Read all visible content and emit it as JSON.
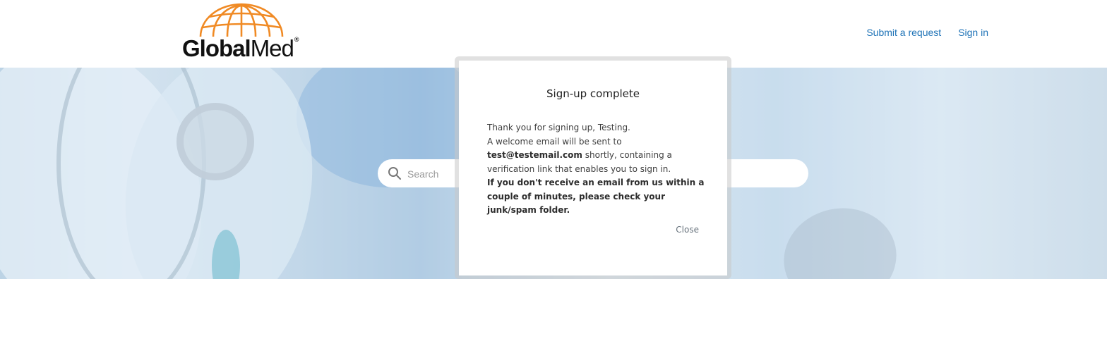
{
  "header": {
    "logo_alt": "GlobalMed",
    "logo_text_bold": "Global",
    "logo_text_light": "Med",
    "logo_reg": "®",
    "nav": {
      "submit_request": "Submit a request",
      "sign_in": "Sign in"
    }
  },
  "hero": {
    "search": {
      "placeholder": "Search",
      "icon": "search-icon"
    }
  },
  "modal": {
    "title": "Sign-up complete",
    "line1": "Thank you for signing up, Testing.",
    "line2": "A welcome email will be sent to",
    "email": "test@testemail.com",
    "line3_after_email": " shortly, containing a",
    "line4": "verification link that enables you to sign in.",
    "warning": "If you don't receive an email from us within a couple of minutes, please check your junk/spam folder.",
    "close_label": "Close"
  },
  "colors": {
    "link": "#1f73b7",
    "logo_orange": "#f08a24"
  }
}
